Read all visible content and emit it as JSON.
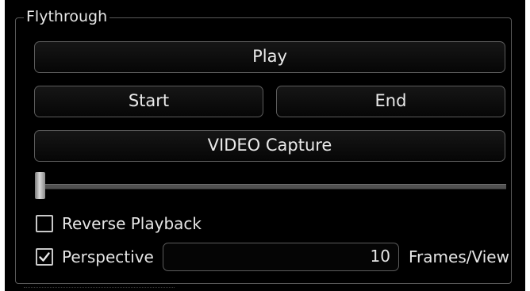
{
  "group": {
    "title": "Flythrough"
  },
  "buttons": {
    "play": "Play",
    "start": "Start",
    "end": "End",
    "video_capture": "VIDEO Capture"
  },
  "slider": {
    "value_fraction": 0.0
  },
  "options": {
    "reverse_playback": {
      "label": "Reverse Playback",
      "checked": false
    },
    "perspective": {
      "label": "Perspective",
      "checked": true
    }
  },
  "frames": {
    "value": "10",
    "unit_label": "Frames/View"
  },
  "colors": {
    "background": "#000000",
    "border": "#5c5c5c",
    "text": "#e6e6e6"
  }
}
